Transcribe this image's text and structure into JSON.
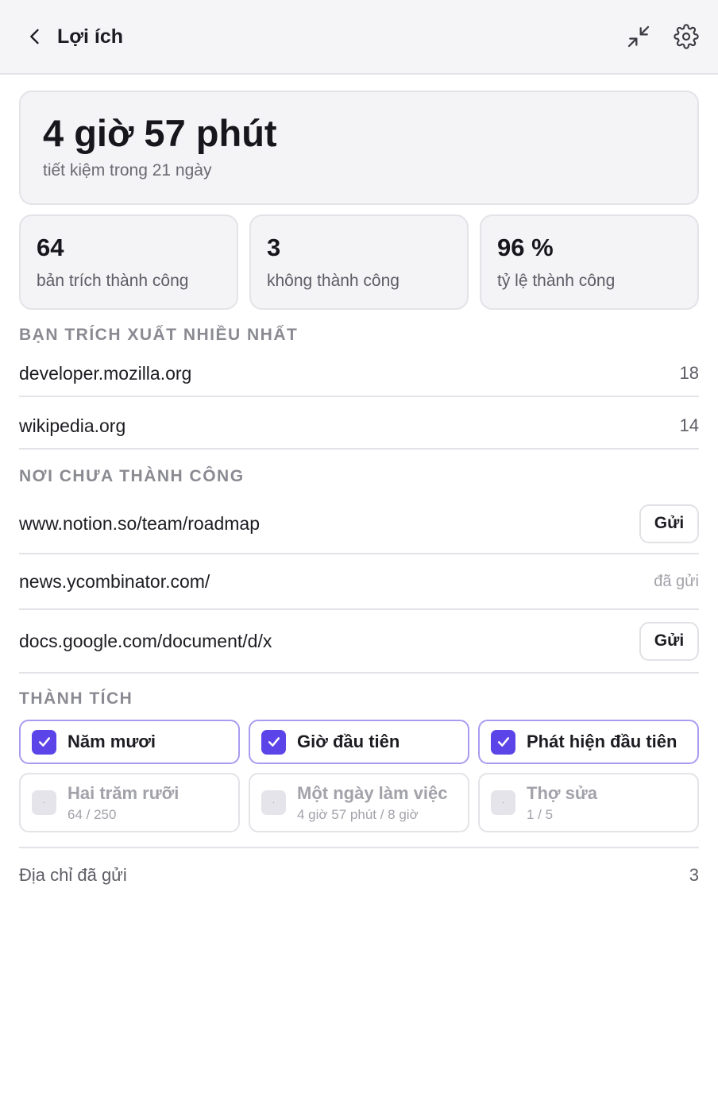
{
  "header": {
    "title": "Lợi ích",
    "back_icon": "chevron-left-icon",
    "collapse_icon": "collapse-arrows-icon",
    "settings_icon": "gear-icon"
  },
  "hero": {
    "value": "4 giờ 57 phút",
    "subtitle": "tiết kiệm trong 21 ngày"
  },
  "stats": [
    {
      "value": "64",
      "label": "bản trích thành công"
    },
    {
      "value": "3",
      "label": "không thành công"
    },
    {
      "value": "96 %",
      "label": "tỷ lệ thành công"
    }
  ],
  "top_sites": {
    "title": "BẠN TRÍCH XUẤT NHIỀU NHẤT",
    "items": [
      {
        "domain": "developer.mozilla.org",
        "count": "18"
      },
      {
        "domain": "wikipedia.org",
        "count": "14"
      }
    ]
  },
  "failures": {
    "title": "NƠI CHƯA THÀNH CÔNG",
    "items": [
      {
        "url": "www.notion.so/team/roadmap",
        "action": "Gửi"
      },
      {
        "url": "news.ycombinator.com/",
        "status": "đã gửi"
      },
      {
        "url": "docs.google.com/document/d/x",
        "action": "Gửi"
      }
    ]
  },
  "achievements": {
    "title": "THÀNH TÍCH",
    "unlocked": [
      {
        "label": "Năm mươi"
      },
      {
        "label": "Giờ đầu tiên"
      },
      {
        "label": "Phát hiện đầu tiên"
      }
    ],
    "locked": [
      {
        "label": "Hai trăm rưỡi",
        "progress": "64 / 250"
      },
      {
        "label": "Một ngày làm việc",
        "progress": "4 giờ 57 phút / 8 giờ"
      },
      {
        "label": "Thợ sửa",
        "progress": "1 / 5"
      }
    ]
  },
  "footer": {
    "label": "Địa chỉ đã gửi",
    "count": "3"
  },
  "colors": {
    "accent": "#5b45e8",
    "accent_border": "#a99cf0",
    "header_bg": "#f5f5f7",
    "card_bg": "#f4f4f7"
  }
}
